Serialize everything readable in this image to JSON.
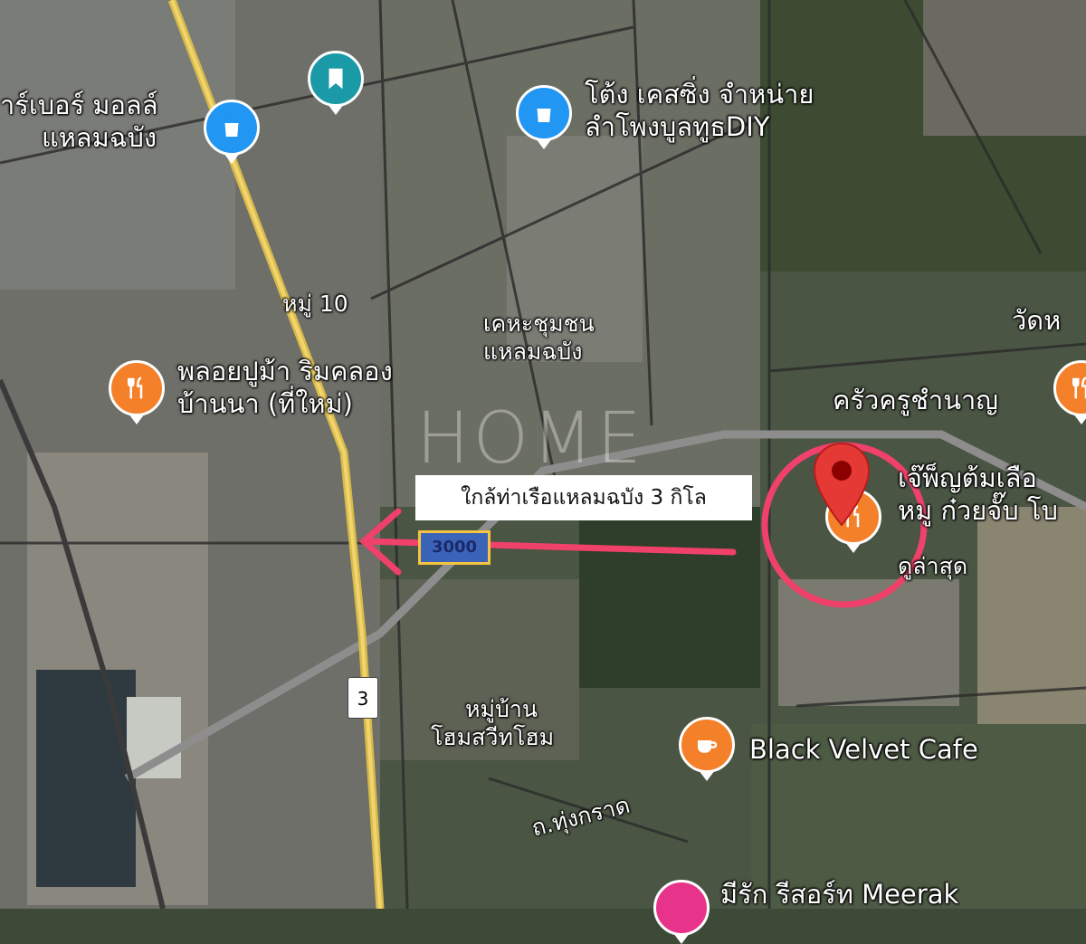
{
  "labels": {
    "mall": [
      "าร์เบอร์ มอลล์",
      "แหลมฉบัง"
    ],
    "tong_case": [
      "โต้ง เคสซิ่ง จำหน่าย",
      "ลำโพงบูลทูธDIY"
    ],
    "moo10": "หมู่ 10",
    "community_house": [
      "เคหะชุมชน",
      "แหลมฉบัง"
    ],
    "temple": "วัดห",
    "ploy_pu_ma": [
      "พลอยปูม้า ริมคลอง",
      "บ้านนา (ที่ใหม่)"
    ],
    "krua_kru": "ครัวครูชำนาญ",
    "jae_pen": [
      "เจ๊พ็ญต้มเลือ",
      "หมู ก๋วยจั๊บ โบ"
    ],
    "view_latest": "ดูล่าสุด",
    "village": [
      "หมู่บ้าน",
      "โฮมสวีทโฮม"
    ],
    "black_velvet": "Black Velvet Cafe",
    "road_thung_krad": "ถ.ทุ่งกราด",
    "resort": "มีรัก รีสอร์ท Meerak"
  },
  "route_shield": "3",
  "road_sign": "3000",
  "callout": "ใกล้ท่าเรือแหลมฉบัง 3 กิโล",
  "watermark": "HOME",
  "colors": {
    "shopping": "#2196f3",
    "bookmark": "#1a9aa6",
    "food": "#f4802a",
    "cafe": "#f4802a",
    "resort": "#e7348a",
    "location_pin": "#e53935",
    "annotation": "#f0416a"
  },
  "icons": {
    "mall_pin": "shopping-bag-icon",
    "tong_pin": "shopping-bag-icon",
    "bookmark_pin": "bookmark-icon",
    "ploy_pin": "restaurant-icon",
    "krua_pin": "restaurant-icon",
    "jae_pin": "restaurant-icon",
    "cafe_pin": "coffee-cup-icon",
    "target_pin": "location-pin-icon"
  }
}
